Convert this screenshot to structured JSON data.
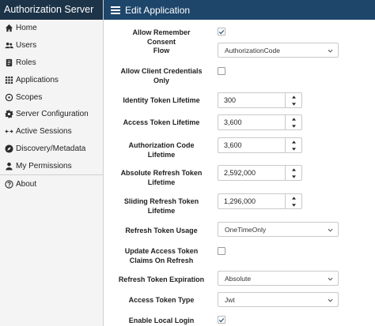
{
  "sidebar": {
    "brand": "Authorization Server",
    "items": [
      {
        "label": "Home",
        "icon": "home-icon"
      },
      {
        "label": "Users",
        "icon": "users-icon"
      },
      {
        "label": "Roles",
        "icon": "roles-icon"
      },
      {
        "label": "Applications",
        "icon": "applications-icon"
      },
      {
        "label": "Scopes",
        "icon": "scopes-icon"
      },
      {
        "label": "Server Configuration",
        "icon": "gear-icon"
      },
      {
        "label": "Active Sessions",
        "icon": "sessions-icon"
      },
      {
        "label": "Discovery/Metadata",
        "icon": "compass-icon"
      },
      {
        "label": "My Permissions",
        "icon": "person-icon"
      },
      {
        "label": "About",
        "icon": "help-icon"
      }
    ]
  },
  "header": {
    "title": "Edit Application",
    "menu_icon": "hamburger-icon"
  },
  "form": {
    "allow_remember_consent": {
      "label": "Allow Remember Consent",
      "checked": true
    },
    "flow": {
      "label": "Flow",
      "value": "AuthorizationCode"
    },
    "allow_client_credentials_only": {
      "label": "Allow Client Credentials Only",
      "checked": false
    },
    "identity_token_lifetime": {
      "label": "Identity Token Lifetime",
      "value": "300"
    },
    "access_token_lifetime": {
      "label": "Access Token Lifetime",
      "value": "3,600"
    },
    "authorization_code_lifetime": {
      "label": "Authorization Code Lifetime",
      "value": "3,600"
    },
    "absolute_refresh_token_lifetime": {
      "label": "Absolute Refresh Token Lifetime",
      "value": "2,592,000"
    },
    "sliding_refresh_token_lifetime": {
      "label": "Sliding Refresh Token Lifetime",
      "value": "1,296,000"
    },
    "refresh_token_usage": {
      "label": "Refresh Token Usage",
      "value": "OneTimeOnly"
    },
    "update_access_token_claims": {
      "label": "Update Access Token Claims On Refresh",
      "checked": false
    },
    "refresh_token_expiration": {
      "label": "Refresh Token Expiration",
      "value": "Absolute"
    },
    "access_token_type": {
      "label": "Access Token Type",
      "value": "Jwt"
    },
    "enable_local_login": {
      "label": "Enable Local Login",
      "checked": true
    }
  },
  "colors": {
    "brand_bg": "#1c3348",
    "topbar_bg": "#1e466b",
    "sidebar_bg": "#f4f4f4",
    "check_color": "#1e466b"
  }
}
